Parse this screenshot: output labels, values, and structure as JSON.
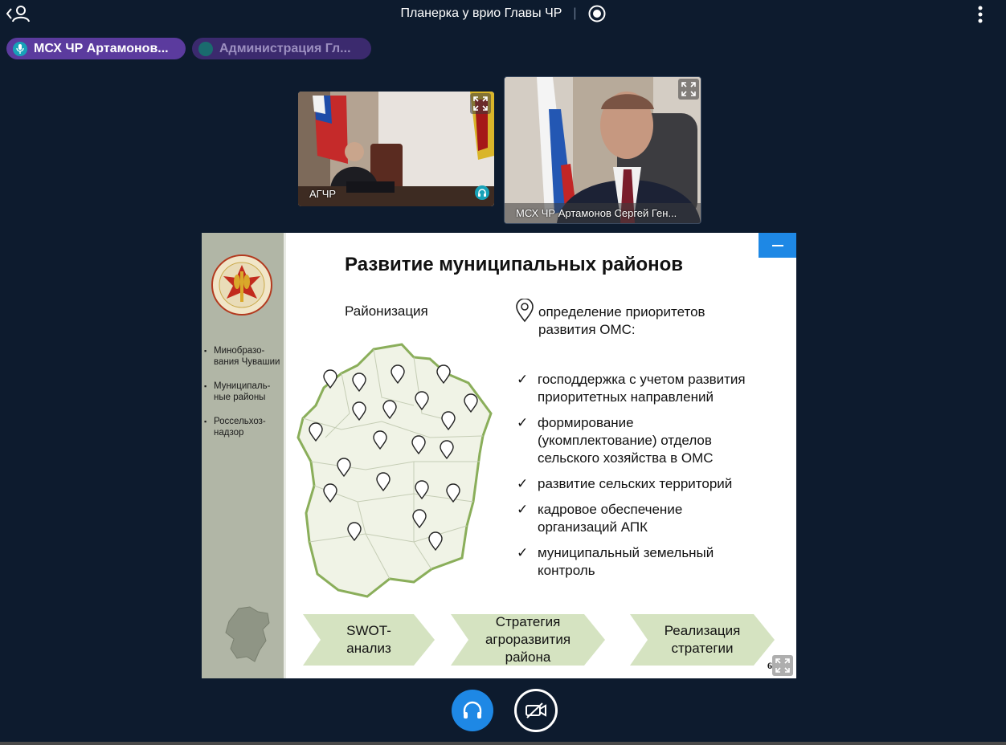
{
  "header": {
    "title": "Планерка у врио Главы ЧР",
    "separator": "|"
  },
  "participants_chips": [
    {
      "label": "МСХ ЧР Артамонов..."
    },
    {
      "label": "Администрация Гл..."
    }
  ],
  "video_tiles": [
    {
      "label": "АГЧР"
    },
    {
      "label": "МСХ ЧР Артамонов Сергей Ген..."
    }
  ],
  "slide": {
    "title": "Развитие муниципальных районов",
    "subtitle": "Районизация",
    "pin_text_line1": "определение приоритетов",
    "pin_text_line2": "развития ОМС:",
    "side_items": [
      {
        "line1": "Минобразо-",
        "line2": "вания  Чувашии"
      },
      {
        "line1": "Муниципаль-",
        "line2": "ные районы"
      },
      {
        "line1": "Россельхоз-",
        "line2": "надзор"
      }
    ],
    "bullets": [
      {
        "line1": "господдержка с учетом развития",
        "line2": "приоритетных направлений",
        "line3": ""
      },
      {
        "line1": "формирование",
        "line2": "(укомплектование) отделов",
        "line3": "сельского хозяйства в ОМС"
      },
      {
        "line1": "развитие сельских территорий",
        "line2": "",
        "line3": ""
      },
      {
        "line1": "кадровое обеспечение",
        "line2": "организаций АПК",
        "line3": ""
      },
      {
        "line1": "муниципальный земельный",
        "line2": "контроль",
        "line3": ""
      }
    ],
    "steps": [
      {
        "line1": "SWOT-",
        "line2": "анализ",
        "line3": ""
      },
      {
        "line1": "Стратегия",
        "line2": "агроразвития",
        "line3": "района"
      },
      {
        "line1": "Реализация",
        "line2": "стратегии",
        "line3": ""
      }
    ],
    "page_number": "6",
    "colors": {
      "sidebar": "#b1b6a6",
      "map_fill": "#f0f3e6",
      "map_border": "#8aae5a",
      "step_fill": "#d5e3c1"
    }
  },
  "controls": {
    "icons": [
      "headphones-icon",
      "camera-off-icon"
    ]
  }
}
